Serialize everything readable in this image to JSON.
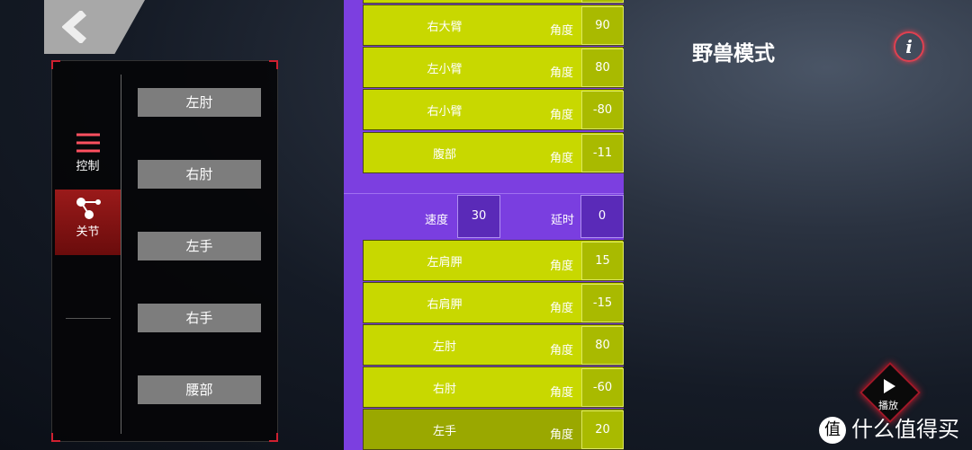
{
  "header": {
    "title": "野兽模式",
    "info_icon": "info-icon"
  },
  "sidebar": {
    "tabs": [
      {
        "label": "控制",
        "icon": "sliders-icon"
      },
      {
        "label": "关节",
        "icon": "joint-icon",
        "active": true
      }
    ]
  },
  "joints": [
    "左肘",
    "右肘",
    "左手",
    "右手",
    "腰部"
  ],
  "rows_top": [
    {
      "name": "",
      "label": "角度",
      "value": ""
    },
    {
      "name": "右大臂",
      "label": "角度",
      "value": "90"
    },
    {
      "name": "左小臂",
      "label": "角度",
      "value": "80"
    },
    {
      "name": "右小臂",
      "label": "角度",
      "value": "-80"
    },
    {
      "name": "腹部",
      "label": "角度",
      "value": "-11"
    }
  ],
  "timing": {
    "speed_label": "速度",
    "speed": "30",
    "delay_label": "延时",
    "delay": "0"
  },
  "rows_bottom": [
    {
      "name": "左肩胛",
      "label": "角度",
      "value": "15"
    },
    {
      "name": "右肩胛",
      "label": "角度",
      "value": "-15"
    },
    {
      "name": "左肘",
      "label": "角度",
      "value": "80"
    },
    {
      "name": "右肘",
      "label": "角度",
      "value": "-60"
    },
    {
      "name": "左手",
      "label": "角度",
      "value": "20"
    }
  ],
  "play": {
    "label": "播放"
  },
  "watermark": {
    "logo": "值",
    "text": "什么值得买"
  },
  "colors": {
    "purple": "#7c3fe0",
    "green": "#c8d800",
    "accent": "#d02030"
  }
}
